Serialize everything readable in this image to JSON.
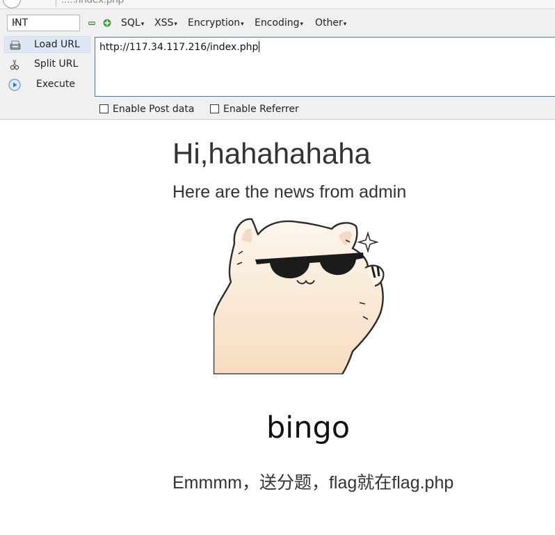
{
  "browser": {
    "url_fragment": "...../index.php"
  },
  "hackbar": {
    "select_value": "INT",
    "menus": [
      {
        "label": "SQL"
      },
      {
        "label": "XSS"
      },
      {
        "label": "Encryption"
      },
      {
        "label": "Encoding"
      },
      {
        "label": "Other"
      }
    ],
    "side_items": [
      {
        "label": "Load URL"
      },
      {
        "label": "Split URL"
      },
      {
        "label": "Execute"
      }
    ],
    "url_value": "http://117.34.117.216/index.php",
    "checkboxes": [
      {
        "label": "Enable Post data",
        "checked": false
      },
      {
        "label": "Enable Referrer",
        "checked": false
      }
    ],
    "icons": [
      "minus-icon",
      "plus-icon",
      "load-url-icon",
      "split-url-icon",
      "execute-icon"
    ]
  },
  "page": {
    "title": "Hi,hahahahaha",
    "subtitle": "Here are the news from admin",
    "image_word": "bingo",
    "footer": "Emmmm，送分题，flag就在flag.php"
  },
  "colors": {
    "toolbar_bg": "#f0f0f0",
    "url_border": "#3c7fb1",
    "plus_minus_green": "#3aa535",
    "active_item_bg": "#dde8f4"
  }
}
